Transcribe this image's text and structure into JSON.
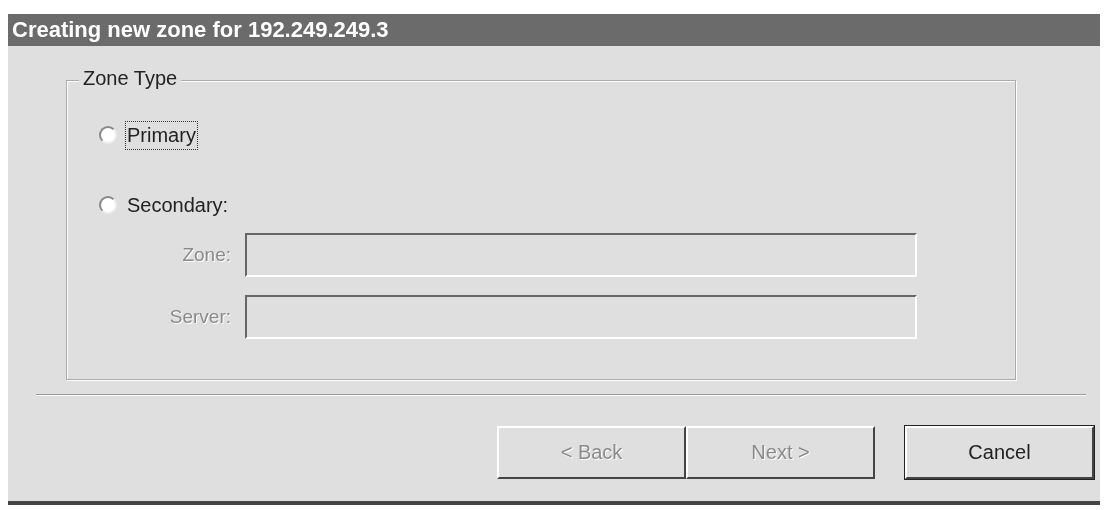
{
  "window": {
    "title": "Creating new zone for 192.249.249.3"
  },
  "zone_type": {
    "legend": "Zone Type",
    "options": [
      {
        "label": "Primary",
        "selected": false,
        "focused": true
      },
      {
        "label": "Secondary:",
        "selected": false,
        "focused": false
      }
    ],
    "fields": [
      {
        "label": "Zone:",
        "disabled": true
      },
      {
        "label": "Server:",
        "disabled": true
      }
    ]
  },
  "buttons": [
    {
      "label": "< Back",
      "disabled": true,
      "kind": "nav"
    },
    {
      "label": "Next >",
      "disabled": true,
      "kind": "nav"
    },
    {
      "label": "Cancel",
      "disabled": false,
      "kind": "cancel"
    }
  ]
}
